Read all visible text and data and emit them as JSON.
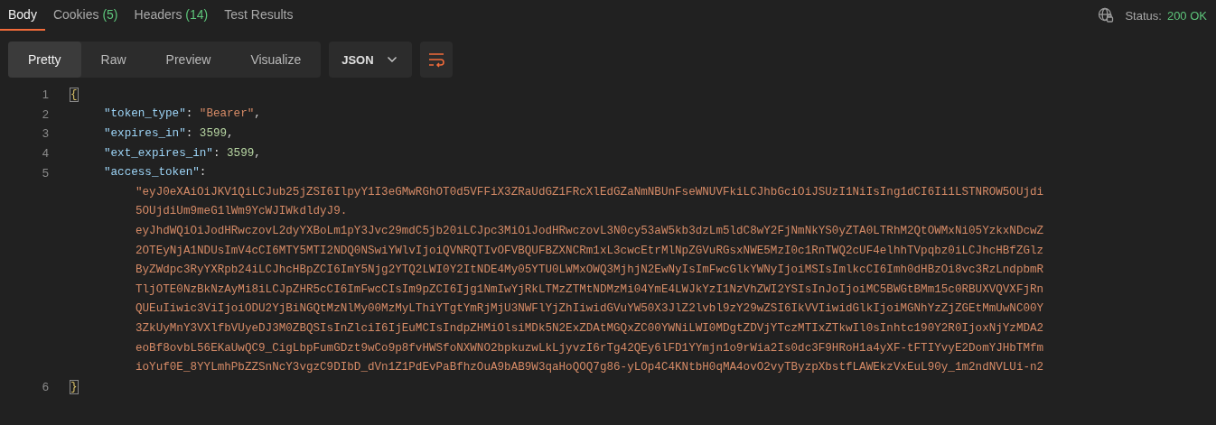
{
  "tabs": [
    {
      "label": "Body",
      "selected": true
    },
    {
      "label": "Cookies",
      "count": "(5)",
      "selected": false
    },
    {
      "label": "Headers",
      "count": "(14)",
      "selected": false
    },
    {
      "label": "Test Results",
      "selected": false
    }
  ],
  "status": {
    "label": "Status:",
    "value": "200 OK"
  },
  "view_modes": [
    {
      "label": "Pretty",
      "selected": true
    },
    {
      "label": "Raw",
      "selected": false
    },
    {
      "label": "Preview",
      "selected": false
    },
    {
      "label": "Visualize",
      "selected": false
    }
  ],
  "format": "JSON",
  "lines": [
    {
      "number": "1",
      "tokens": [
        {
          "kind": "brace",
          "text": "{",
          "highlighted": true
        }
      ]
    },
    {
      "number": "2",
      "tokens": [
        {
          "kind": "key",
          "text": "\"token_type\""
        },
        {
          "kind": "punct",
          "text": ": "
        },
        {
          "kind": "string",
          "text": "\"Bearer\""
        },
        {
          "kind": "punct",
          "text": ","
        }
      ]
    },
    {
      "number": "3",
      "tokens": [
        {
          "kind": "key",
          "text": "\"expires_in\""
        },
        {
          "kind": "punct",
          "text": ": "
        },
        {
          "kind": "number",
          "text": "3599"
        },
        {
          "kind": "punct",
          "text": ","
        }
      ]
    },
    {
      "number": "4",
      "tokens": [
        {
          "kind": "key",
          "text": "\"ext_expires_in\""
        },
        {
          "kind": "punct",
          "text": ": "
        },
        {
          "kind": "number",
          "text": "3599"
        },
        {
          "kind": "punct",
          "text": ","
        }
      ]
    },
    {
      "number": "5",
      "tokens": [
        {
          "kind": "key",
          "text": "\"access_token\""
        },
        {
          "kind": "punct",
          "text": ":"
        }
      ]
    },
    {
      "tokens": [
        {
          "kind": "string",
          "text": "\"eyJ0eXAiOiJKV1QiLCJub25jZSI6IlpyY1I3eGMwRGhOT0d5VFFiX3ZRaUdGZ1FRcXlEdGZaNmNBUnFseWNUVFkiLCJhbGciOiJSUzI1NiIsIng1dCI6Ii1LSTNROW5OUjdi"
        }
      ]
    },
    {
      "tokens": [
        {
          "kind": "string",
          "text": "5OUjdiUm9meG1lWm9YcWJIWkdldyJ9."
        }
      ]
    },
    {
      "tokens": [
        {
          "kind": "string",
          "text": "eyJhdWQiOiJodHRwczovL2dyYXBoLm1pY3Jvc29mdC5jb20iLCJpc3MiOiJodHRwczovL3N0cy53aW5kb3dzLm5ldC8wY2FjNmNkYS0yZTA0LTRhM2QtOWMxNi05YzkxNDcwZ"
        }
      ]
    },
    {
      "tokens": [
        {
          "kind": "string",
          "text": "2OTEyNjA1NDUsImV4cCI6MTY5MTI2NDQ0NSwiYWlvIjoiQVNRQTIvOFVBQUFBZXNCRm1xL3cwcEtrMlNpZGVuRGsxNWE5MzI0c1RnTWQ2cUF4elhhTVpqbz0iLCJhcHBfZGlz"
        }
      ]
    },
    {
      "tokens": [
        {
          "kind": "string",
          "text": "ByZWdpc3RyYXRpb24iLCJhcHBpZCI6ImY5Njg2YTQ2LWI0Y2ItNDE4My05YTU0LWMxOWQ3MjhjN2EwNyIsImFwcGlkYWNyIjoiMSIsImlkcCI6Imh0dHBzOi8vc3RzLndpbmR"
        }
      ]
    },
    {
      "tokens": [
        {
          "kind": "string",
          "text": "TljOTE0NzBkNzAyMi8iLCJpZHR5cCI6ImFwcCIsIm9pZCI6Ijg1NmIwYjRkLTMzZTMtNDMzMi04YmE4LWJkYzI1NzVhZWI2YSIsInJoIjoiMC5BWGtBMm15c0RBUXVQVXFjRn"
        }
      ]
    },
    {
      "tokens": [
        {
          "kind": "string",
          "text": "QUEuIiwic3ViIjoiODU2YjBiNGQtMzNlMy00MzMyLThiYTgtYmRjMjU3NWFlYjZhIiwidGVuYW50X3JlZ2lvbl9zY29wZSI6IkVVIiwidGlkIjoiMGNhYzZjZGEtMmUwNC00Y"
        }
      ]
    },
    {
      "tokens": [
        {
          "kind": "string",
          "text": "3ZkUyMnY3VXlfbVUyeDJ3M0ZBQSIsInZlciI6IjEuMCIsIndpZHMiOlsiMDk5N2ExZDAtMGQxZC00YWNiLWI0MDgtZDVjYTczMTIxZTkwIl0sInhtc190Y2R0IjoxNjYzMDA2"
        }
      ]
    },
    {
      "tokens": [
        {
          "kind": "string",
          "text": "eoBf8ovbL56EKaUwQC9_CigLbpFumGDzt9wCo9p8fvHWSfoNXWNO2bpkuzwLkLjyvzI6rTg42QEy6lFD1YYmjn1o9rWia2Is0dc3F9HRoH1a4yXF-tFTIYvyE2DomYJHbTMfm"
        }
      ]
    },
    {
      "tokens": [
        {
          "kind": "string",
          "text": "ioYuf0E_8YYLmhPbZZSnNcY3vgzC9DIbD_dVn1Z1PdEvPaBfhzOuA9bAB9W3qaHoQOQ7g86-yLOp4C4KNtbH0qMA4ovO2vyTByzpXbstfLAWEkzVxEuL90y_1m2ndNVLUi-n2"
        }
      ]
    },
    {
      "number": "6",
      "tokens": [
        {
          "kind": "brace",
          "text": "}",
          "highlighted": true
        }
      ]
    }
  ]
}
